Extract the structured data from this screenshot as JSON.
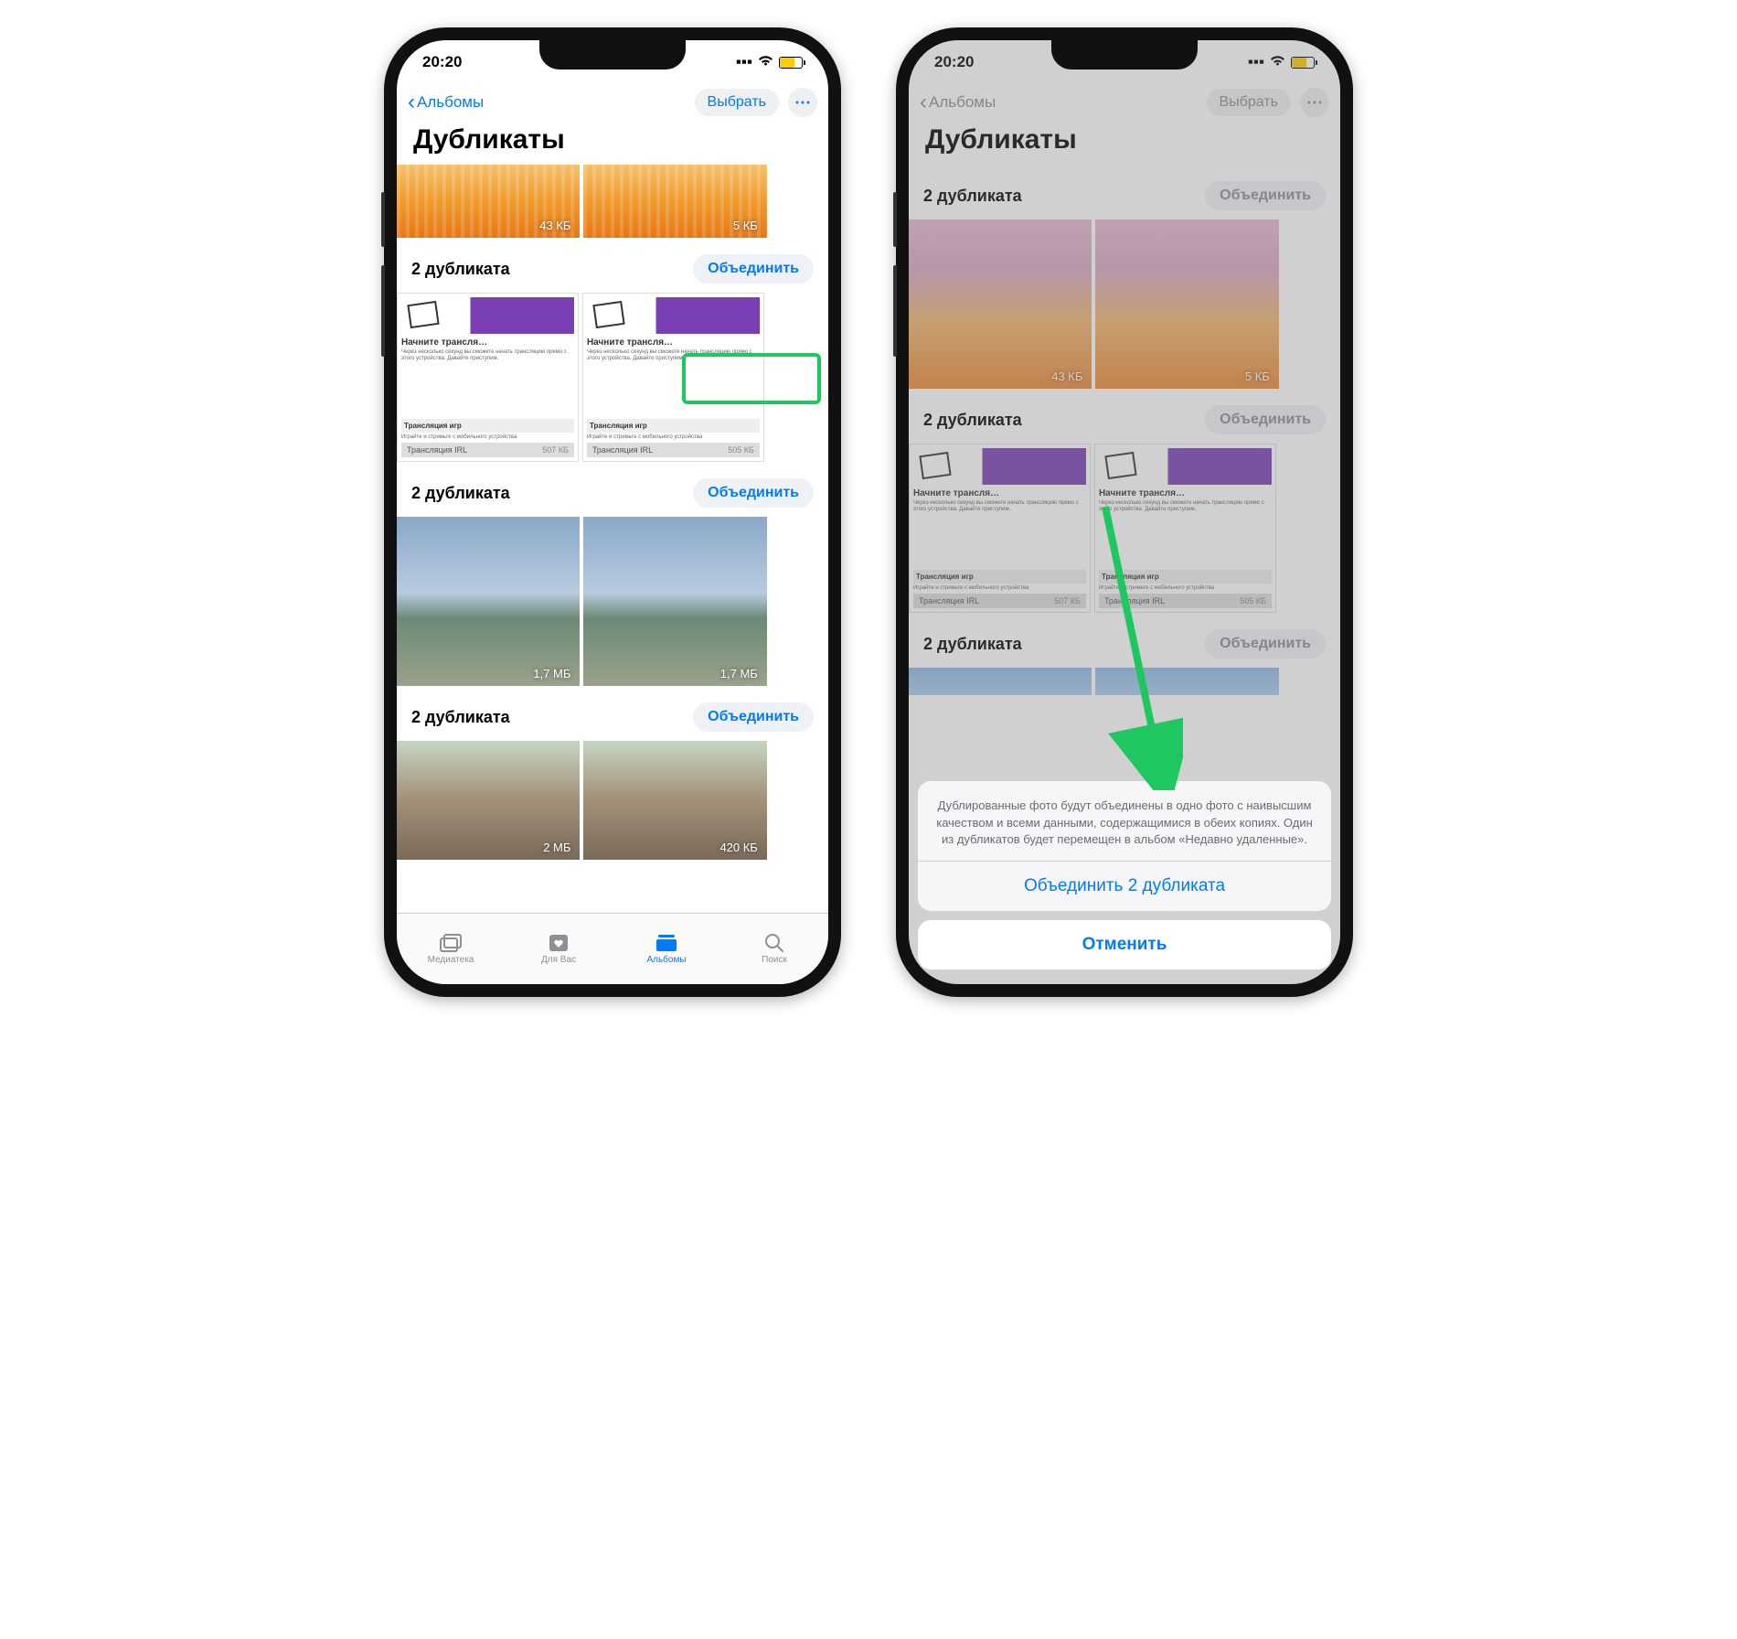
{
  "status": {
    "time": "20:20"
  },
  "nav": {
    "back": "Альбомы",
    "select": "Выбрать",
    "title": "Дубликаты"
  },
  "groups": {
    "g1": {
      "label": "2 дубликата",
      "merge": "Объединить",
      "a_size": "43 КБ",
      "b_size": "5 КБ"
    },
    "g2": {
      "label": "2 дубликата",
      "merge": "Объединить",
      "doc_title": "Начните трансля…",
      "doc_section1": "Трансляция игр",
      "doc_section2": "Трансляция IRL",
      "a_size": "507 КБ",
      "b_size": "505 КБ"
    },
    "g3": {
      "label": "2 дубликата",
      "merge": "Объединить",
      "a_size": "1,7 МБ",
      "b_size": "1,7 МБ"
    },
    "g4": {
      "label": "2 дубликата",
      "merge": "Объединить",
      "a_size": "2 МБ",
      "b_size": "420 КБ"
    }
  },
  "tabs": {
    "media": "Медиатека",
    "foryou": "Для Вас",
    "albums": "Альбомы",
    "search": "Поиск"
  },
  "sheet": {
    "text": "Дублированные фото будут объединены в одно фото с наивысшим качеством и всеми данными, содержащимися в обеих копиях. Один из дубликатов будет перемещен в альбом «Недавно удаленные».",
    "action": "Объединить 2 дубликата",
    "cancel": "Отменить"
  }
}
